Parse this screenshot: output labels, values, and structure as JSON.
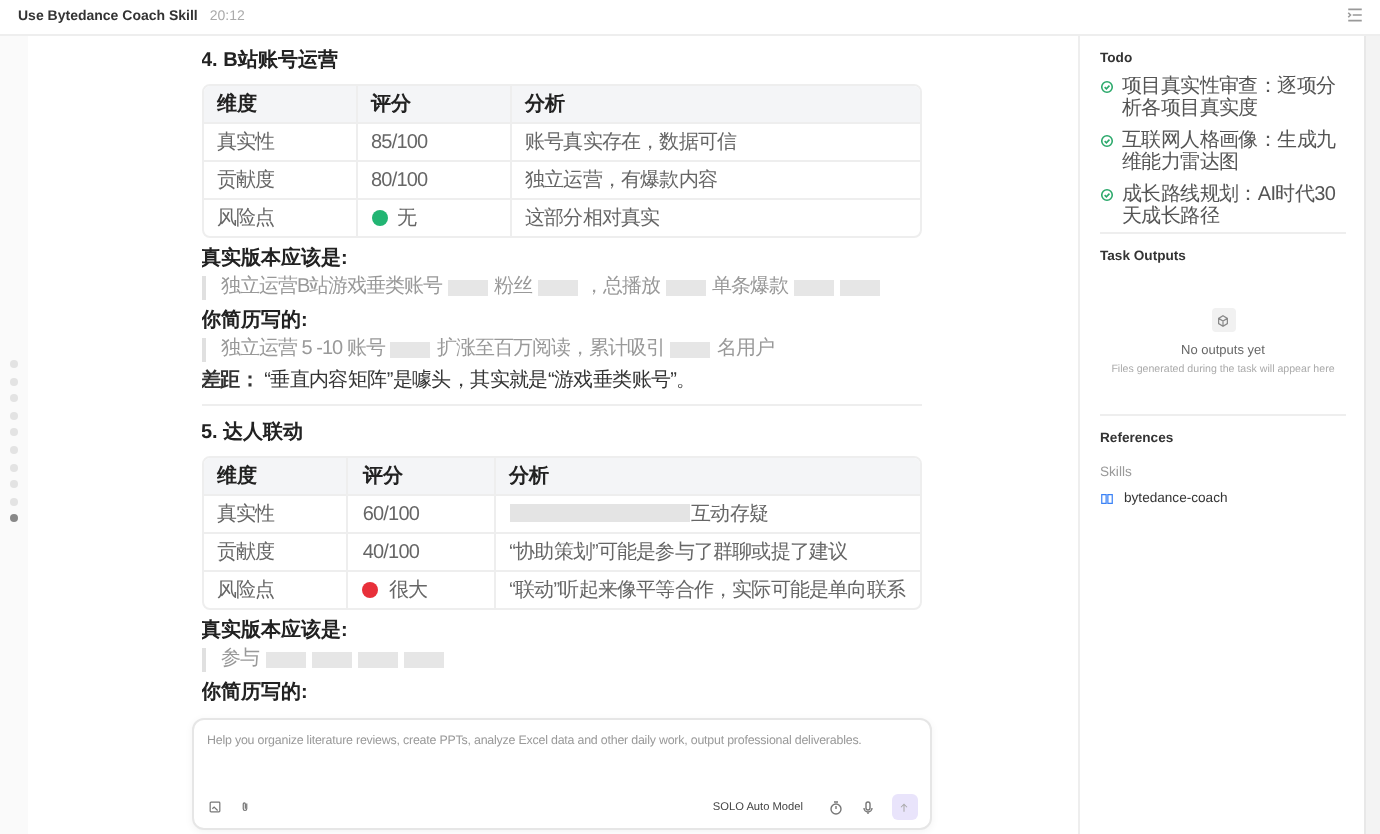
{
  "window": {
    "title": "Use Bytedance Coach Skill",
    "time": "20:12"
  },
  "outline": [
    {
      "selected": false
    },
    {
      "selected": false
    },
    {
      "selected": false
    },
    {
      "selected": false
    },
    {
      "selected": false
    },
    {
      "selected": false
    },
    {
      "selected": false
    },
    {
      "selected": false
    },
    {
      "selected": false
    },
    {
      "selected": true
    }
  ],
  "sections": [
    {
      "heading": "4. B站账号运营",
      "columns": [
        "维度",
        "评分",
        "分析"
      ],
      "rows": [
        {
          "dimension": "真实性",
          "score": "85/100",
          "analysis": "账号真实存在，数据可信"
        },
        {
          "dimension": "贡献度",
          "score": "80/100",
          "analysis": "独立运营，有爆款内容"
        },
        {
          "dimension": "风险点",
          "score": "无",
          "color": "#22b573",
          "analysis": "这部分相对真实"
        }
      ],
      "blocks": [
        {
          "kind": "label",
          "text": "真实版本应该是:"
        },
        {
          "kind": "quote",
          "segments": [
            {
              "kind": "text",
              "text": "独立运营B站游戏垂类账号"
            },
            {
              "kind": "redacted"
            },
            {
              "kind": "text",
              "text": "粉丝"
            },
            {
              "kind": "redacted"
            },
            {
              "kind": "text",
              "text": "，总播放"
            },
            {
              "kind": "redacted"
            },
            {
              "kind": "text",
              "text": "单条爆款"
            },
            {
              "kind": "redacted"
            },
            {
              "kind": "redacted"
            }
          ]
        },
        {
          "kind": "label",
          "text": "你简历写的:"
        },
        {
          "kind": "quote",
          "segments": [
            {
              "kind": "text",
              "text": "独立运营 5 -10 账号"
            },
            {
              "kind": "redacted"
            },
            {
              "kind": "text",
              "text": "扩涨至百万阅读，累计吸引"
            },
            {
              "kind": "redacted"
            },
            {
              "kind": "text",
              "text": "名用户"
            }
          ]
        },
        {
          "kind": "note",
          "text": "**差距：** “垂直内容矩阵”是噱头，其实就是“游戏垂类账号”。"
        }
      ]
    },
    {
      "heading": "5. 达人联动",
      "columns": [
        "维度",
        "评分",
        "分析"
      ],
      "rows": [
        {
          "dimension": "真实性",
          "score": "60/100",
          "analysis": "互动存疑",
          "redacted": true
        },
        {
          "dimension": "贡献度",
          "score": "40/100",
          "analysis": "“协助策划”可能是参与了群聊或提了建议"
        },
        {
          "dimension": "风险点",
          "score": "很大",
          "color": "#e8303a",
          "analysis": "“联动”听起来像平等合作，实际可能是单向联系"
        }
      ],
      "blocks": [
        {
          "kind": "label",
          "text": "真实版本应该是:"
        },
        {
          "kind": "quote",
          "segments": [
            {
              "kind": "text",
              "text": "参与"
            },
            {
              "kind": "redacted"
            },
            {
              "kind": "redacted"
            },
            {
              "kind": "redacted"
            },
            {
              "kind": "redacted"
            }
          ]
        },
        {
          "kind": "label",
          "text": "你简历写的:"
        }
      ]
    }
  ],
  "todo": {
    "title": "Todo",
    "items": [
      {
        "text": "项目真实性审查：逐项分析各项目真实度",
        "checked": true
      },
      {
        "text": "互联网人格画像：生成九维能力雷达图",
        "checked": true
      },
      {
        "text": "成长路线规划：AI时代30天成长路径",
        "checked": true
      }
    ]
  },
  "task_outputs": {
    "title": "Task Outputs",
    "empty_title": "No outputs yet",
    "empty_hint": "Files generated during the task will appear here"
  },
  "references": {
    "title": "References",
    "group": "Skills",
    "items": [
      "bytedance-coach"
    ]
  },
  "composer": {
    "placeholder": "Help you organize literature reviews, create PPTs, analyze Excel data and other daily work, output professional deliverables.",
    "model": "SOLO Auto Model"
  }
}
